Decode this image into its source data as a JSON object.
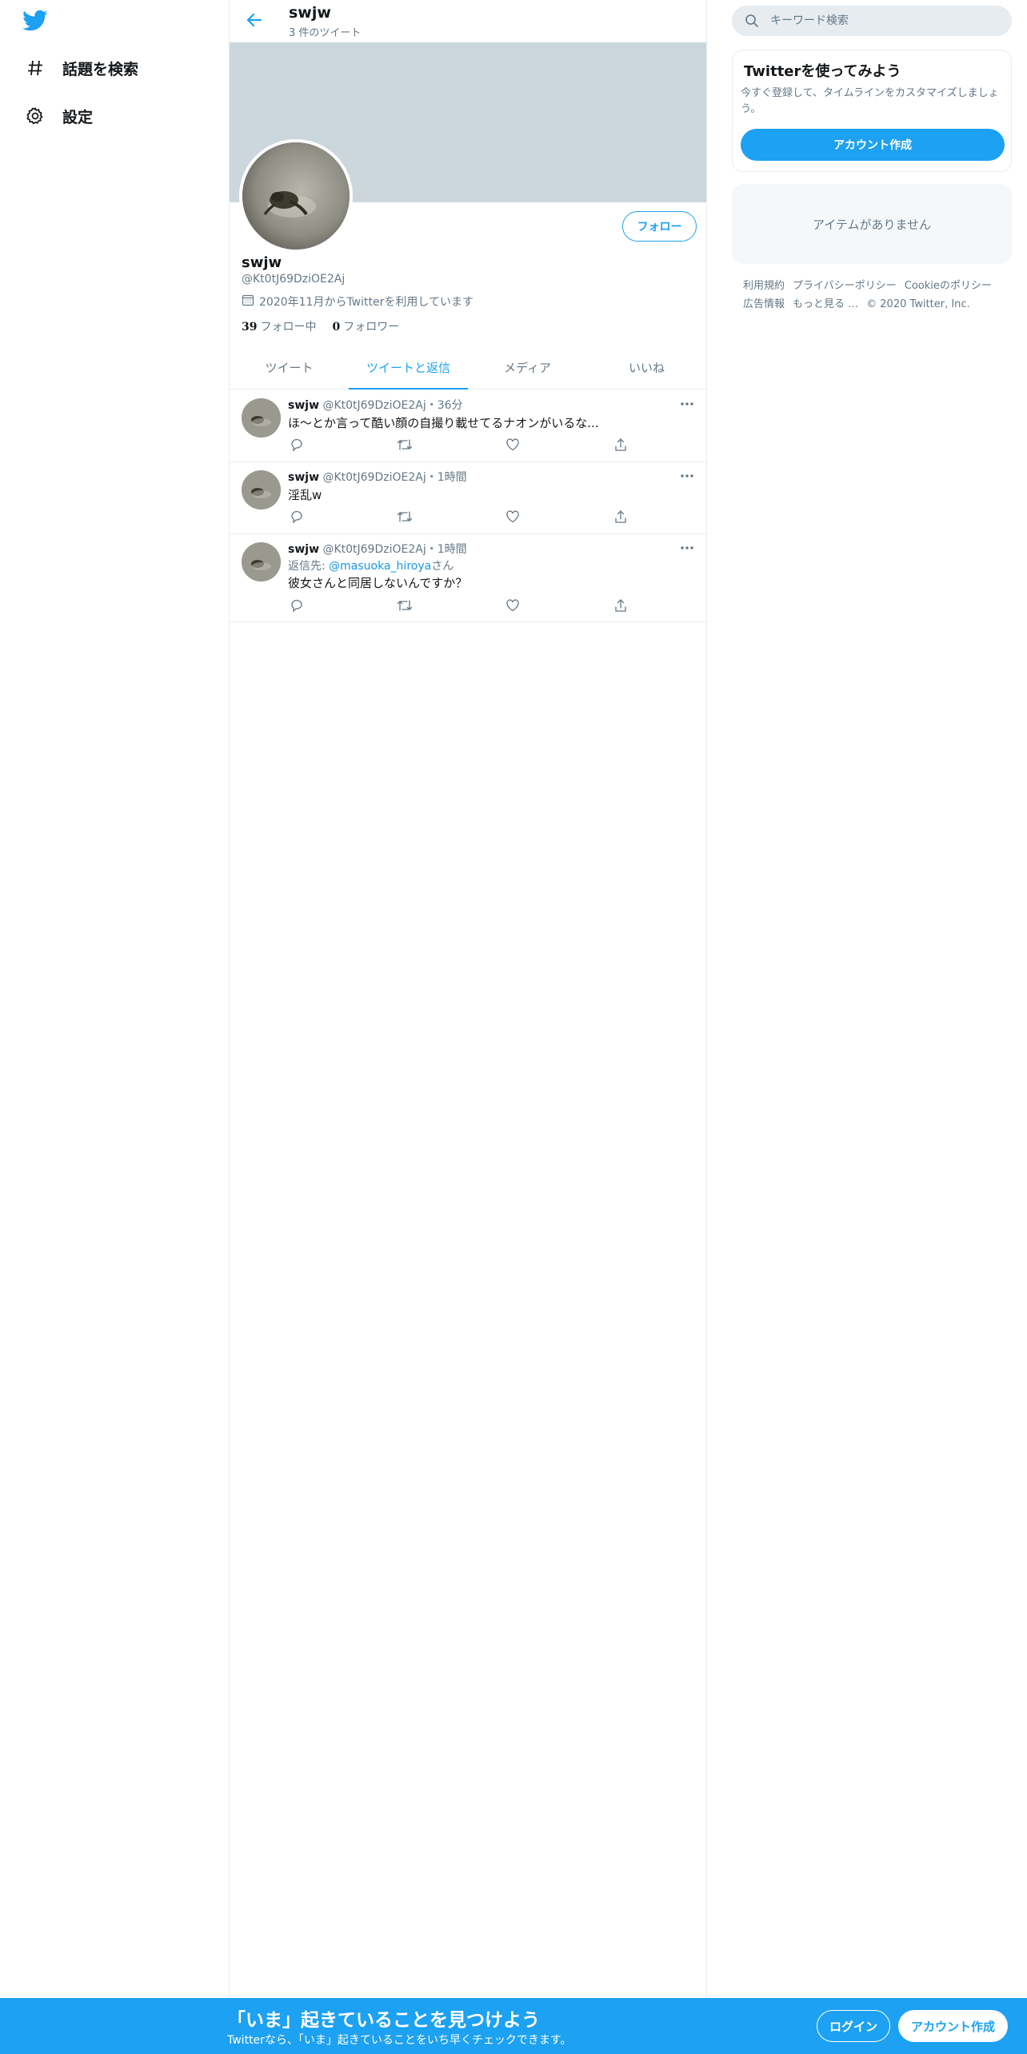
{
  "colors": {
    "brand": "#1da1f2",
    "banner": "#ccd6dd",
    "muted": "#657786",
    "text": "#14171a"
  },
  "left_nav": {
    "logo_icon": "twitter-bird-icon",
    "items": [
      {
        "icon": "hashtag-icon",
        "label": "話題を検索"
      },
      {
        "icon": "gear-icon",
        "label": "設定"
      }
    ]
  },
  "header": {
    "back_icon": "arrow-left-icon",
    "title": "swjw",
    "subtitle": "3 件のツイート"
  },
  "profile": {
    "name": "swjw",
    "handle": "@Kt0tJ69DziOE2Aj",
    "joined": "2020年11月からTwitterを利用しています",
    "following_count": "39",
    "following_label": "フォロー中",
    "followers_count": "0",
    "followers_label": "フォロワー",
    "follow_button": "フォロー"
  },
  "tabs": [
    {
      "label": "ツイート",
      "active": false
    },
    {
      "label": "ツイートと返信",
      "active": true
    },
    {
      "label": "メディア",
      "active": false
    },
    {
      "label": "いいね",
      "active": false
    }
  ],
  "tweets": [
    {
      "name": "swjw",
      "handle": "@Kt0tJ69DziOE2Aj",
      "time": "・36分",
      "reply_prefix": "",
      "reply_to": "",
      "reply_suffix": "",
      "text": "ほ〜とか言って酷い顔の自撮り載せてるナオンがいるな..."
    },
    {
      "name": "swjw",
      "handle": "@Kt0tJ69DziOE2Aj",
      "time": "・1時間",
      "reply_prefix": "",
      "reply_to": "",
      "reply_suffix": "",
      "text": "淫乱w"
    },
    {
      "name": "swjw",
      "handle": "@Kt0tJ69DziOE2Aj",
      "time": "・1時間",
      "reply_prefix": "返信先: ",
      "reply_to": "@masuoka_hiroya",
      "reply_suffix": "さん",
      "text": "彼女さんと同居しないんですか？"
    }
  ],
  "right": {
    "search_placeholder": "キーワード検索",
    "card_title": "Twitterを使ってみよう",
    "card_text": "今すぐ登録して、タイムラインをカスタマイズしましょう。",
    "signup_button": "アカウント作成",
    "empty_text": "アイテムがありません",
    "footer_links": [
      "利用規約",
      "プライバシーポリシー",
      "Cookieのポリシー",
      "広告情報",
      "もっと見る …",
      "© 2020 Twitter, Inc."
    ]
  },
  "bottom_bar": {
    "title": "「いま」起きていることを見つけよう",
    "subtitle": "Twitterなら、「いま」起きていることをいち早くチェックできます。",
    "login_button": "ログイン",
    "signup_button": "アカウント作成"
  }
}
